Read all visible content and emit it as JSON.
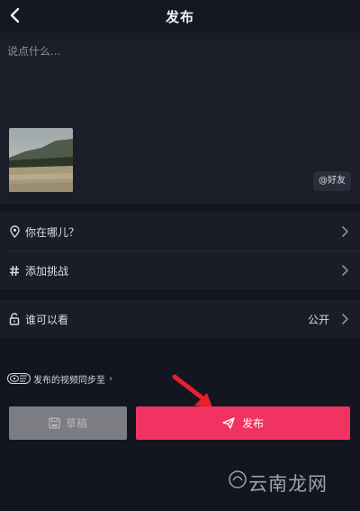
{
  "header": {
    "title": "发布",
    "back_icon": "chevron-left-icon"
  },
  "compose": {
    "caption_placeholder": "说点什么...",
    "mention_label": "@好友"
  },
  "settings": {
    "location": {
      "label": "你在哪儿？",
      "icon": "location-pin-icon"
    },
    "challenge": {
      "label": "添加挑战",
      "icon": "hashtag-icon"
    },
    "visibility": {
      "label": "谁可以看",
      "value": "公开",
      "icon": "lock-open-icon"
    }
  },
  "sync": {
    "label": "发布的视频同步至",
    "chevron": "›"
  },
  "actions": {
    "draft_label": "草稿",
    "publish_label": "发布"
  },
  "watermark": {
    "text": "云南龙网"
  },
  "colors": {
    "background": "#131520",
    "panel": "#1b1d29",
    "publish": "#f03360",
    "draft": "#7c7d83",
    "arrow": "#e8202a"
  }
}
